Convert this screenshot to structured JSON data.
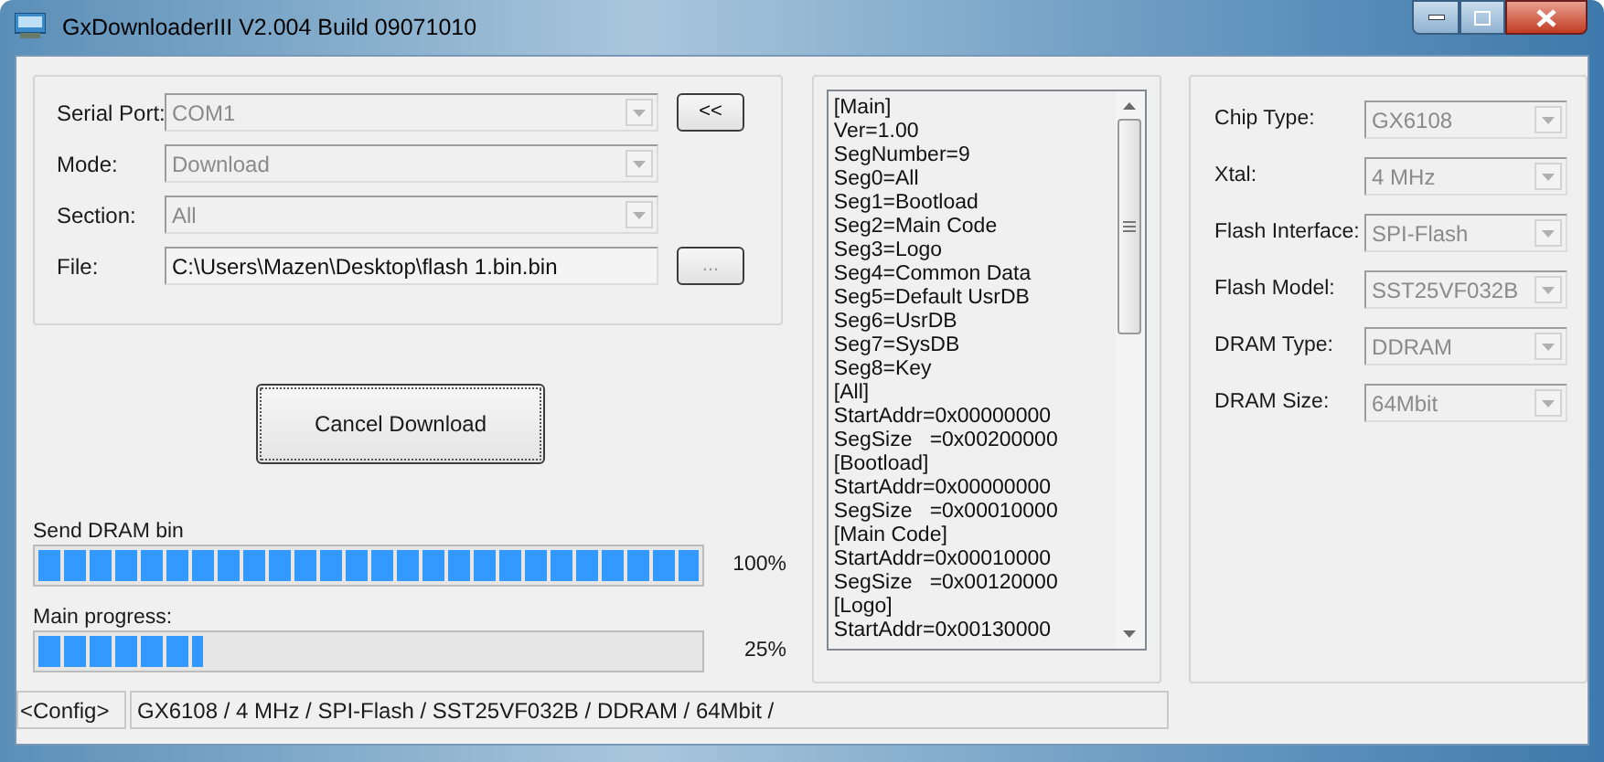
{
  "window": {
    "title": "GxDownloaderIII V2.004 Build 09071010"
  },
  "port_settings": [
    {
      "label": "Serial Port:",
      "value": "COM1",
      "kind": "combo",
      "disabled": true,
      "button": "<<"
    },
    {
      "label": "Mode:",
      "value": "Download",
      "kind": "combo",
      "disabled": true
    },
    {
      "label": "Section:",
      "value": "All",
      "kind": "combo",
      "disabled": true
    },
    {
      "label": "File:",
      "value": "C:\\Users\\Mazen\\Desktop\\flash 1.bin.bin",
      "kind": "text",
      "disabled": false,
      "button": "..."
    }
  ],
  "action_button": "Cancel Download",
  "progress": [
    {
      "label": "Send DRAM bin",
      "level": 1,
      "reading": "100%"
    },
    {
      "label": "Main progress:",
      "level": 0.25,
      "reading": "25%"
    }
  ],
  "config_listing": [
    "[Main]",
    "Ver=1.00",
    "SegNumber=9",
    "Seg0=All",
    "Seg1=Bootload",
    "Seg2=Main Code",
    "Seg3=Logo",
    "Seg4=Common Data",
    "Seg5=Default UsrDB",
    "Seg6=UsrDB",
    "Seg7=SysDB",
    "Seg8=Key",
    "[All]",
    "StartAddr=0x00000000",
    "SegSize   =0x00200000",
    "[Bootload]",
    "StartAddr=0x00000000",
    "SegSize   =0x00010000",
    "[Main Code]",
    "StartAddr=0x00010000",
    "SegSize   =0x00120000",
    "[Logo]",
    "StartAddr=0x00130000"
  ],
  "chip_settings": [
    {
      "label": "Chip Type:",
      "value": "GX6108",
      "disabled": true
    },
    {
      "label": "Xtal:",
      "value": "4 MHz",
      "disabled": true
    },
    {
      "label": "Flash Interface:",
      "value": "SPI-Flash",
      "disabled": true
    },
    {
      "label": "Flash Model:",
      "value": "SST25VF032B",
      "disabled": true
    },
    {
      "label": "DRAM Type:",
      "value": "DDRAM",
      "disabled": true
    },
    {
      "label": "DRAM Size:",
      "value": "64Mbit",
      "disabled": true
    }
  ],
  "status_bar": {
    "label": "<Config>",
    "value": "GX6108 / 4 MHz / SPI-Flash / SST25VF032B / DDRAM / 64Mbit /"
  }
}
